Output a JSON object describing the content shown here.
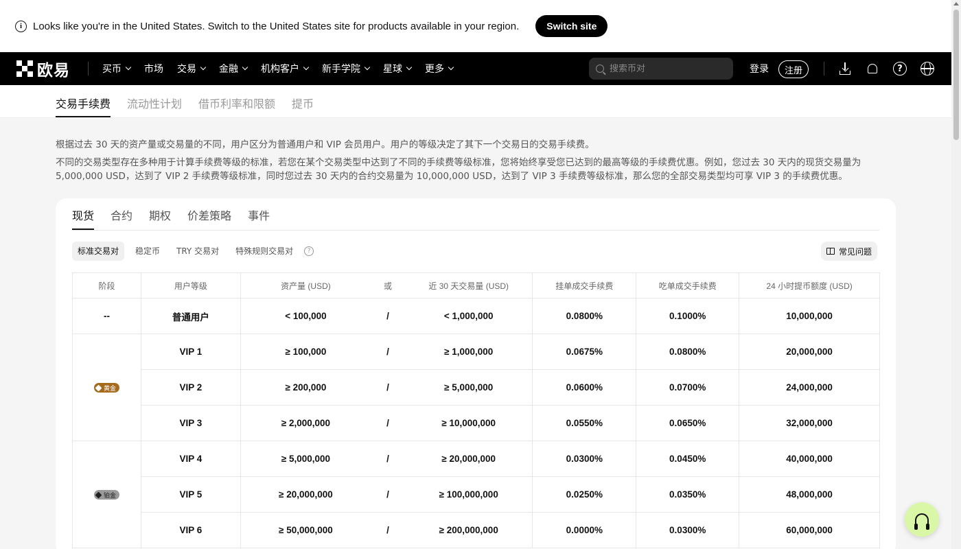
{
  "banner": {
    "message": "Looks like you're in the United States. Switch to the United States site for products available in your region.",
    "switch_label": "Switch site"
  },
  "nav": {
    "logo_text": "欧易",
    "menu": [
      "买币",
      "市场",
      "交易",
      "金融",
      "机构客户",
      "新手学院",
      "星球",
      "更多"
    ],
    "search_placeholder": "搜索币对",
    "login": "登录",
    "register": "注册"
  },
  "subtabs": [
    "交易手续费",
    "流动性计划",
    "借币利率和限额",
    "提币"
  ],
  "description": {
    "p1": "根据过去 30 天的资产量或交易量的不同，用户区分为普通用户和 VIP 会员用户。用户的等级决定了其下一个交易日的交易手续费。",
    "p2": "不同的交易类型存在多种用于计算手续费等级的标准，若您在某个交易类型中达到了不同的手续费等级标准，您将始终享受您已达到的最高等级的手续费优惠。例如，您过去 30 天内的现货交易量为 5,000,000 USD，达到了 VIP 2 手续费等级标准，同时您过去 30 天内的合约交易量为 10,000,000 USD，达到了 VIP 3 手续费等级标准，那么您的全部交易类型均可享 VIP 3 的手续费优惠。"
  },
  "tabs": [
    "现货",
    "合约",
    "期权",
    "价差策略",
    "事件"
  ],
  "pills": [
    "标准交易对",
    "稳定币",
    "TRY 交易对",
    "特殊规则交易对"
  ],
  "faq_label": "常见问题",
  "table": {
    "headers": [
      "阶段",
      "用户等级",
      "资产量 (USD)",
      "或",
      "近 30 天交易量 (USD)",
      "挂单成交手续费",
      "吃单成交手续费",
      "24 小时提币额度 (USD)"
    ],
    "stages": {
      "none": "--",
      "gold": "黄金",
      "platinum": "铂金"
    },
    "rows": [
      {
        "level": "普通用户",
        "assets": "< 100,000",
        "sep": "/",
        "volume": "< 1,000,000",
        "maker": "0.0800%",
        "taker": "0.1000%",
        "withdraw": "10,000,000"
      },
      {
        "level": "VIP 1",
        "assets": "≥ 100,000",
        "sep": "/",
        "volume": "≥ 1,000,000",
        "maker": "0.0675%",
        "taker": "0.0800%",
        "withdraw": "20,000,000"
      },
      {
        "level": "VIP 2",
        "assets": "≥ 200,000",
        "sep": "/",
        "volume": "≥ 5,000,000",
        "maker": "0.0600%",
        "taker": "0.0700%",
        "withdraw": "24,000,000"
      },
      {
        "level": "VIP 3",
        "assets": "≥ 2,000,000",
        "sep": "/",
        "volume": "≥ 10,000,000",
        "maker": "0.0550%",
        "taker": "0.0650%",
        "withdraw": "32,000,000"
      },
      {
        "level": "VIP 4",
        "assets": "≥ 5,000,000",
        "sep": "/",
        "volume": "≥ 20,000,000",
        "maker": "0.0300%",
        "taker": "0.0450%",
        "withdraw": "40,000,000"
      },
      {
        "level": "VIP 5",
        "assets": "≥ 20,000,000",
        "sep": "/",
        "volume": "≥ 100,000,000",
        "maker": "0.0250%",
        "taker": "0.0350%",
        "withdraw": "48,000,000"
      },
      {
        "level": "VIP 6",
        "assets": "≥ 50,000,000",
        "sep": "/",
        "volume": "≥ 200,000,000",
        "maker": "0.0000%",
        "taker": "0.0300%",
        "withdraw": "60,000,000"
      }
    ]
  },
  "colors": {
    "gold_badge": "#a66a1c",
    "platinum_badge": "#9a9a9a",
    "support_button": "#d9f7a6"
  }
}
